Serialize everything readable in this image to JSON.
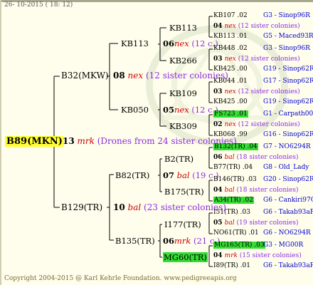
{
  "header": {
    "date": "26- 10-2015 ( 18: 12)"
  },
  "root": {
    "id": "B89(MKN)",
    "year": "13",
    "mark": "mrk",
    "note": "(Drones from 24 sister colonies)"
  },
  "gen2": [
    {
      "id": "B32(MKW)",
      "year": "08",
      "mark": "nex",
      "note": "(12 sister colonies)"
    },
    {
      "id": "B129(TR)",
      "year": "10",
      "mark": "bal",
      "note": "(23 sister colonies)"
    }
  ],
  "gen3": [
    {
      "id": "KB113",
      "year": "06",
      "mark": "nex",
      "note": "(12 c.)"
    },
    {
      "id": "KB050",
      "year": "05",
      "mark": "nex",
      "note": "(12 c.)"
    },
    {
      "id": "B82(TR)",
      "year": "07",
      "mark": "bal",
      "note": "(19 c.)"
    },
    {
      "id": "B135(TR)",
      "year": "06",
      "mark": "mrk",
      "note": "(21 c.)"
    }
  ],
  "gen4": [
    "KB113",
    "KB266",
    "KB109",
    "KB309",
    "B2(TR)",
    "B175(TR)",
    "I177(TR)",
    "MG60(TR)"
  ],
  "gen5": [
    {
      "kind": "id",
      "id": "KB107",
      "year": ".02",
      "ref": "G3 - Sinop96R"
    },
    {
      "kind": "mate",
      "year": "04",
      "mark": "nex",
      "note": "(12 sister colonies)"
    },
    {
      "kind": "id",
      "id": "KB113",
      "year": ".01",
      "ref": "G5 - Maced93R"
    },
    {
      "kind": "id",
      "id": "KB448",
      "year": ".02",
      "ref": "G3 - Sinop96R"
    },
    {
      "kind": "mate",
      "year": "03",
      "mark": "nex",
      "note": "(12 sister colonies)"
    },
    {
      "kind": "id",
      "id": "KB425",
      "year": ".00",
      "ref": "G19 - Sinop62R"
    },
    {
      "kind": "id",
      "id": "KB044",
      "year": ".01",
      "ref": "G17 - Sinop62R"
    },
    {
      "kind": "mate",
      "year": "03",
      "mark": "nex",
      "note": "(12 sister colonies)"
    },
    {
      "kind": "id",
      "id": "KB425",
      "year": ".00",
      "ref": "G19 - Sinop62R"
    },
    {
      "kind": "id",
      "id": "FS723",
      "year": ".01",
      "ref": "G1 - Carpath00R",
      "hl": true
    },
    {
      "kind": "mate",
      "year": "02",
      "mark": "nex",
      "note": "(12 sister colonies)"
    },
    {
      "kind": "id",
      "id": "KB068",
      "year": ".99",
      "ref": "G16 - Sinop62R"
    },
    {
      "kind": "id",
      "id": "B132(TR)",
      "year": ".04",
      "ref": "G7 - NO6294R",
      "hl": true
    },
    {
      "kind": "mate",
      "year": "06",
      "mark": "bal",
      "note": "(18 sister colonies)"
    },
    {
      "kind": "id",
      "id": "B77(TR)",
      "year": ".04",
      "ref": "G8 - Old_Lady"
    },
    {
      "kind": "id",
      "id": "B146(TR)",
      "year": ".03",
      "ref": "G20 - Sinop62R"
    },
    {
      "kind": "mate",
      "year": "04",
      "mark": "bal",
      "note": "(18 sister colonies)"
    },
    {
      "kind": "id",
      "id": "A34(TR)",
      "year": ".02",
      "ref": "G6 - Cankiri97Q",
      "hl": true
    },
    {
      "kind": "id",
      "id": "I51(TR)",
      "year": ".03",
      "ref": "G6 - Takab93aR"
    },
    {
      "kind": "mate",
      "year": "05",
      "mark": "bal",
      "note": "(19 sister colonies)"
    },
    {
      "kind": "id",
      "id": "NO61(TR)",
      "year": ".01",
      "ref": "G6 - NO6294R"
    },
    {
      "kind": "id",
      "id": "MG165(TR)",
      "year": ".03",
      "ref": "G3 - MG00R",
      "hl": true
    },
    {
      "kind": "mate",
      "year": "04",
      "mark": "mrk",
      "note": "(15 sister colonies)"
    },
    {
      "kind": "id",
      "id": "I89(TR)",
      "year": ".01",
      "ref": "G6 - Takab93aR"
    }
  ],
  "footer": {
    "text": "Copyright 2004-2015 @ Karl Kehrle Foundation.   www.pedigreeapis.org"
  }
}
